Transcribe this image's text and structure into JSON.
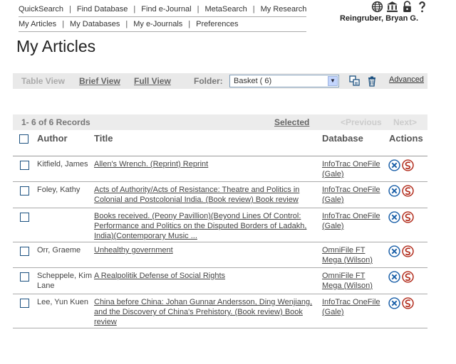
{
  "nav": {
    "row1": [
      {
        "label": "QuickSearch"
      },
      {
        "label": "Find Database"
      },
      {
        "label": "Find e-Journal"
      },
      {
        "label": "MetaSearch"
      },
      {
        "label": "My Research"
      }
    ],
    "row2": [
      {
        "label": "My Articles"
      },
      {
        "label": "My Databases"
      },
      {
        "label": "My e-Journals"
      },
      {
        "label": "Preferences"
      }
    ],
    "icons": [
      "globe-icon",
      "library-icon",
      "lock-icon",
      "help-icon"
    ]
  },
  "user": {
    "name": "Reingruber, Bryan G."
  },
  "page": {
    "title": "My Articles"
  },
  "toolbar": {
    "table_view": "Table View",
    "brief_view": "Brief View",
    "full_view": "Full View",
    "folder_label": "Folder:",
    "folder_value": "Basket ( 6)",
    "advanced": "Advanced"
  },
  "records": {
    "count": "1- 6 of 6 Records",
    "selected": "Selected",
    "prev": "<Previous",
    "next": "Next>"
  },
  "table": {
    "headers": {
      "author": "Author",
      "title": "Title",
      "database": "Database",
      "actions": "Actions"
    },
    "rows": [
      {
        "author": "Kitfield, James",
        "title": "Allen's Wrench. (Reprint) Reprint",
        "database": "InfoTrac OneFile (Gale)"
      },
      {
        "author": "Foley, Kathy",
        "title": "Acts of Authority/Acts of Resistance: Theatre and Politics in Colonial and Postcolonial India. (Book review) Book review",
        "database": "InfoTrac OneFile (Gale)"
      },
      {
        "author": "",
        "title": "Books received. (Peony Pavillion)(Beyond Lines Of Control: Performance and Politics on the Disputed Borders of Ladakh, India)(Contemporary Music ...",
        "database": "InfoTrac OneFile (Gale)"
      },
      {
        "author": "Orr, Graeme",
        "title": "Unhealthy government",
        "database": "OmniFile FT Mega (Wilson)"
      },
      {
        "author": "Scheppele, Kim Lane",
        "title": "A Realpolitik Defense of Social Rights",
        "database": "OmniFile FT Mega (Wilson)"
      },
      {
        "author": "Lee, Yun Kuen",
        "title": "China before China: Johan Gunnar Andersson, Ding Wenjiang, and the Discovery of China's Prehistory. (Book review) Book review",
        "database": "InfoTrac OneFile (Gale)"
      }
    ]
  },
  "colors": {
    "accent": "#1c5180",
    "remove": "#1a5fa8",
    "export": "#b12a1a",
    "toolbar_bg": "#e9e9e9"
  }
}
